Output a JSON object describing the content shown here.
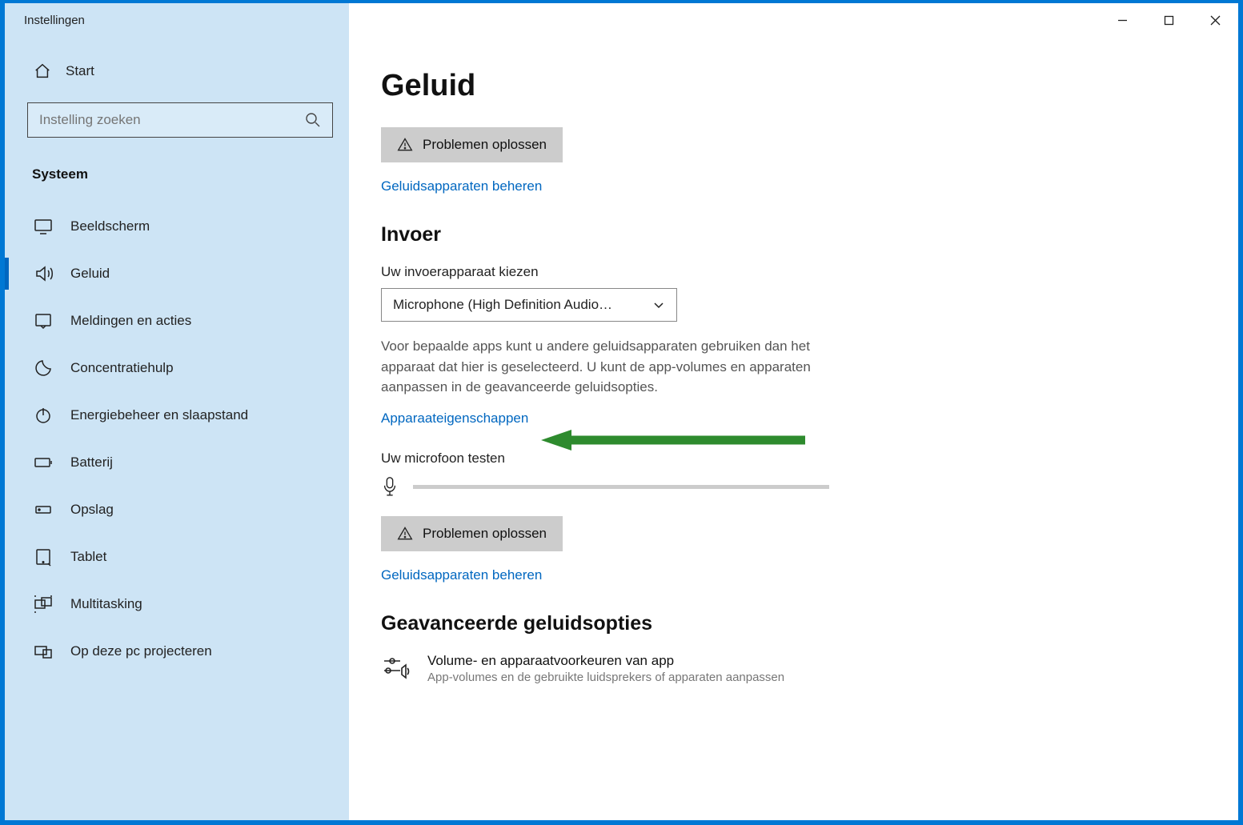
{
  "window": {
    "title": "Instellingen"
  },
  "sidebar": {
    "home": "Start",
    "search_placeholder": "Instelling zoeken",
    "category": "Systeem",
    "items": [
      {
        "label": "Beeldscherm"
      },
      {
        "label": "Geluid"
      },
      {
        "label": "Meldingen en acties"
      },
      {
        "label": "Concentratiehulp"
      },
      {
        "label": "Energiebeheer en slaapstand"
      },
      {
        "label": "Batterij"
      },
      {
        "label": "Opslag"
      },
      {
        "label": "Tablet"
      },
      {
        "label": "Multitasking"
      },
      {
        "label": "Op deze pc projecteren"
      }
    ]
  },
  "main": {
    "page_title": "Geluid",
    "troubleshoot_label": "Problemen oplossen",
    "manage_devices_label": "Geluidsapparaten beheren",
    "input_section_title": "Invoer",
    "input_choose_label": "Uw invoerapparaat kiezen",
    "input_selected": "Microphone (High Definition Audio…",
    "input_helper": "Voor bepaalde apps kunt u andere geluidsapparaten gebruiken dan het apparaat dat hier is geselecteerd. U kunt de app-volumes en apparaten aanpassen in de geavanceerde geluidsopties.",
    "device_props_label": "Apparaateigenschappen",
    "mic_test_label": "Uw microfoon testen",
    "advanced_section_title": "Geavanceerde geluidsopties",
    "advanced_item_title": "Volume- en apparaatvoorkeuren van app",
    "advanced_item_desc": "App-volumes en de gebruikte luidsprekers of apparaten aanpassen"
  }
}
